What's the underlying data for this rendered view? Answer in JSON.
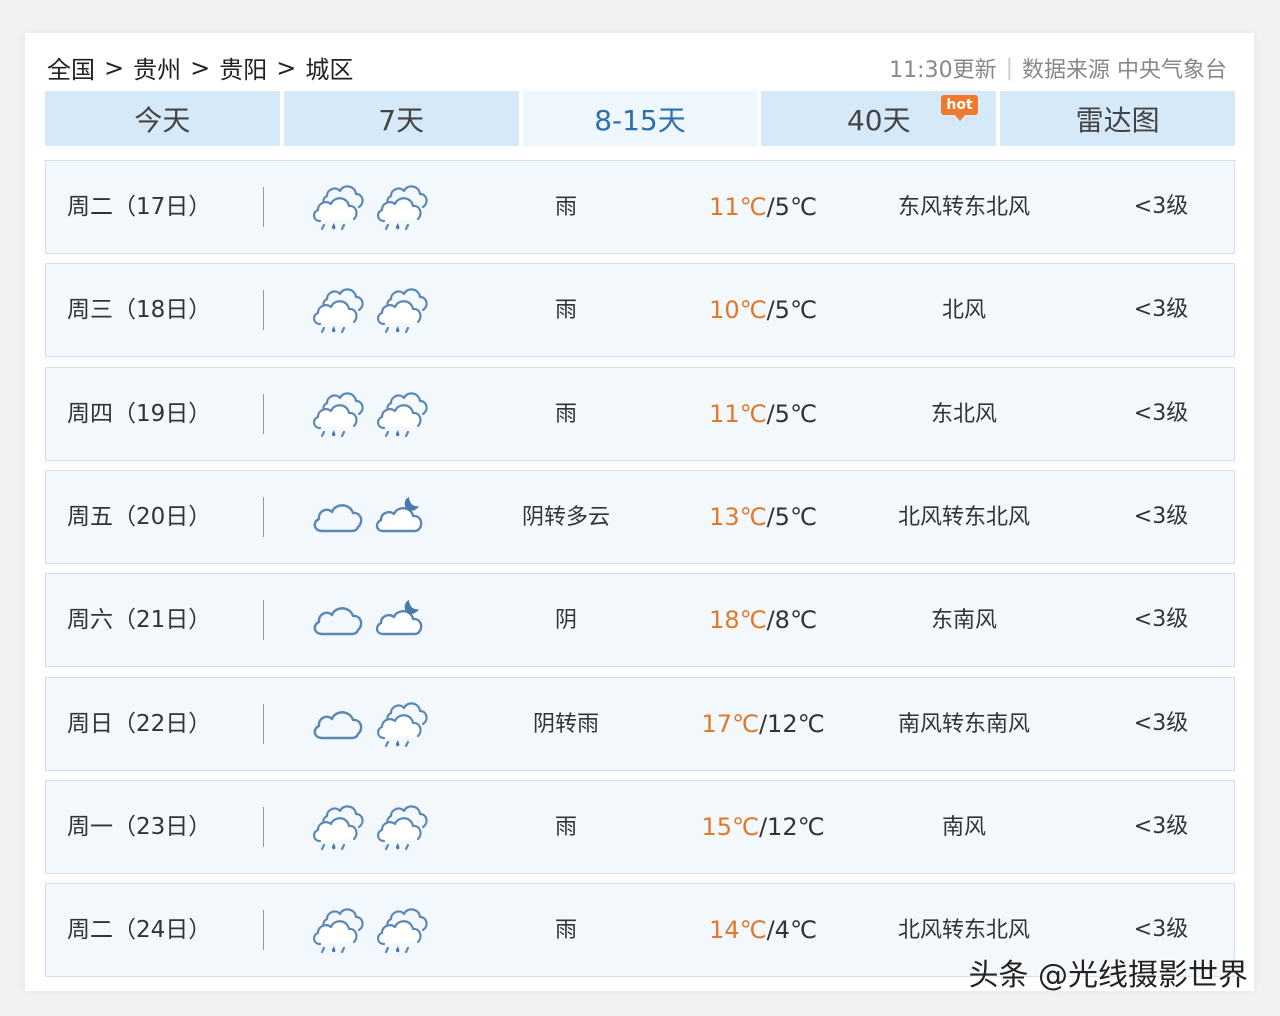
{
  "breadcrumb": [
    "全国",
    "贵州",
    "贵阳",
    "城区"
  ],
  "breadcrumb_sep": ">",
  "update_time": "11:30更新",
  "source": "数据来源 中央气象台",
  "tabs": [
    {
      "label": "今天"
    },
    {
      "label": "7天"
    },
    {
      "label": "8-15天",
      "active": true
    },
    {
      "label": "40天",
      "badge": "hot"
    },
    {
      "label": "雷达图"
    }
  ],
  "colors": {
    "accent": "#2d6fae",
    "high_temp": "#e0782a",
    "tab_bg": "#d6e9f8",
    "row_bg": "#f3f8fd",
    "hot_badge": "#f07a2c"
  },
  "forecast": [
    {
      "day": "周二（17日）",
      "icon_day": "rain-cloud-icon",
      "icon_night": "rain-cloud-icon",
      "desc": "雨",
      "high": "11℃",
      "low": "5℃",
      "wind": "东风转东北风",
      "level": "<3级"
    },
    {
      "day": "周三（18日）",
      "icon_day": "rain-cloud-icon",
      "icon_night": "rain-cloud-icon",
      "desc": "雨",
      "high": "10℃",
      "low": "5℃",
      "wind": "北风",
      "level": "<3级"
    },
    {
      "day": "周四（19日）",
      "icon_day": "rain-cloud-icon",
      "icon_night": "rain-cloud-icon",
      "desc": "雨",
      "high": "11℃",
      "low": "5℃",
      "wind": "东北风",
      "level": "<3级"
    },
    {
      "day": "周五（20日）",
      "icon_day": "overcast-cloud-icon",
      "icon_night": "cloud-moon-icon",
      "desc": "阴转多云",
      "high": "13℃",
      "low": "5℃",
      "wind": "北风转东北风",
      "level": "<3级"
    },
    {
      "day": "周六（21日）",
      "icon_day": "overcast-cloud-icon",
      "icon_night": "cloud-moon-icon",
      "desc": "阴",
      "high": "18℃",
      "low": "8℃",
      "wind": "东南风",
      "level": "<3级"
    },
    {
      "day": "周日（22日）",
      "icon_day": "overcast-cloud-icon",
      "icon_night": "rain-cloud-icon",
      "desc": "阴转雨",
      "high": "17℃",
      "low": "12℃",
      "wind": "南风转东南风",
      "level": "<3级"
    },
    {
      "day": "周一（23日）",
      "icon_day": "rain-cloud-icon",
      "icon_night": "rain-cloud-icon",
      "desc": "雨",
      "high": "15℃",
      "low": "12℃",
      "wind": "南风",
      "level": "<3级"
    },
    {
      "day": "周二（24日）",
      "icon_day": "rain-cloud-icon",
      "icon_night": "rain-cloud-icon",
      "desc": "雨",
      "high": "14℃",
      "low": "4℃",
      "wind": "北风转东北风",
      "level": "<3级"
    }
  ],
  "watermark": "头条 @光线摄影世界"
}
